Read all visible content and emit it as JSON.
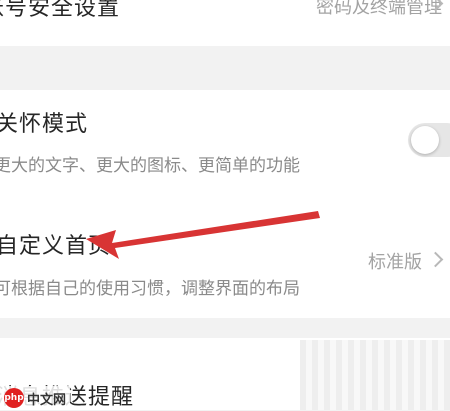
{
  "account_security": {
    "title": "账号安全设置",
    "value": "密码及终端管理"
  },
  "care_mode": {
    "title": "关怀模式",
    "description": "更大的文字、更大的图标、更简单的功能",
    "toggle_on": false
  },
  "custom_home": {
    "title": "自定义首页",
    "description": "可根据自己的使用习惯，调整界面的布局",
    "value": "标准版"
  },
  "push_notify": {
    "title": "消息推送提醒"
  },
  "watermark": {
    "logo": "php",
    "text": "中文网"
  },
  "colors": {
    "background": "#f2f2f2",
    "card": "#ffffff",
    "arrow": "#d83434",
    "toggle_off": "#e6e6e6"
  }
}
